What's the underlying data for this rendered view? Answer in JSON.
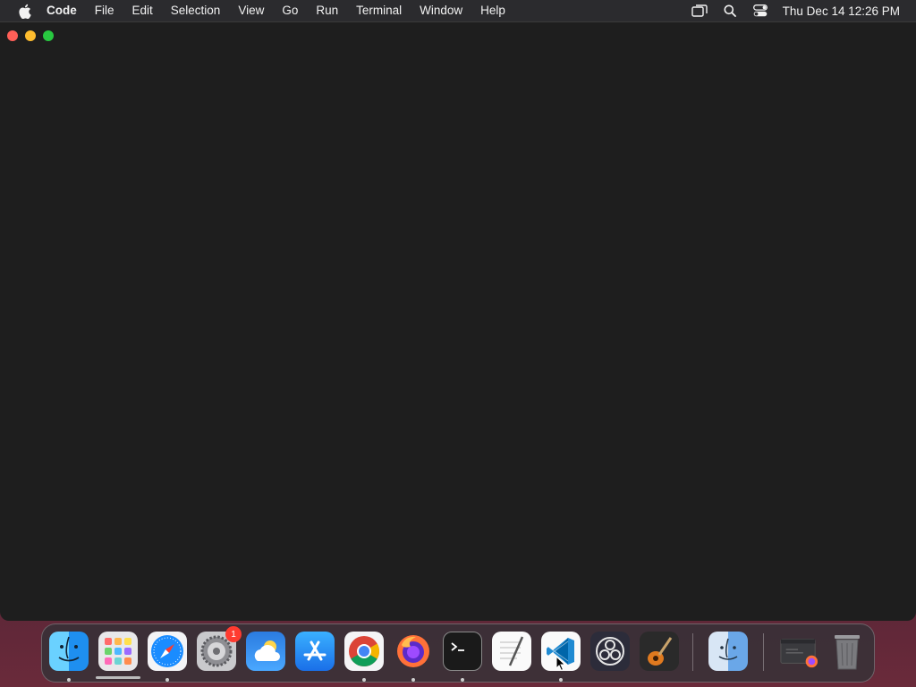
{
  "menubar": {
    "app_name": "Code",
    "items": [
      "File",
      "Edit",
      "Selection",
      "View",
      "Go",
      "Run",
      "Terminal",
      "Window",
      "Help"
    ],
    "clock": "Thu Dec 14  12:26 PM"
  },
  "dock": {
    "apps": [
      {
        "name": "Finder",
        "icon": "finder-icon",
        "running": true
      },
      {
        "name": "Launchpad",
        "icon": "launchpad-icon",
        "running": false
      },
      {
        "name": "Safari",
        "icon": "safari-icon",
        "running": true
      },
      {
        "name": "System Settings",
        "icon": "settings-icon",
        "running": false,
        "badge": "1"
      },
      {
        "name": "Weather",
        "icon": "weather-icon",
        "running": false
      },
      {
        "name": "App Store",
        "icon": "app-store-icon",
        "running": false
      },
      {
        "name": "Chrome",
        "icon": "chrome-icon",
        "running": true
      },
      {
        "name": "Firefox",
        "icon": "firefox-icon",
        "running": true
      },
      {
        "name": "Terminal",
        "icon": "terminal-icon",
        "running": true
      },
      {
        "name": "TextEdit",
        "icon": "textedit-icon",
        "running": false
      },
      {
        "name": "Visual Studio Code",
        "icon": "vscode-icon",
        "running": true
      },
      {
        "name": "OBS",
        "icon": "obs-icon",
        "running": false
      },
      {
        "name": "GarageBand",
        "icon": "garageband-icon",
        "running": false
      }
    ],
    "extras": [
      {
        "name": "Finder",
        "icon": "finder-utility-icon"
      },
      {
        "name": "Downloads",
        "icon": "downloads-stack-icon"
      },
      {
        "name": "Trash",
        "icon": "trash-icon"
      }
    ]
  },
  "colors": {
    "menubar_bg": "#2b2b2e",
    "window_bg": "#1e1e1e",
    "close": "#ff5f57",
    "minimize": "#febc2e",
    "maximize": "#28c840"
  }
}
